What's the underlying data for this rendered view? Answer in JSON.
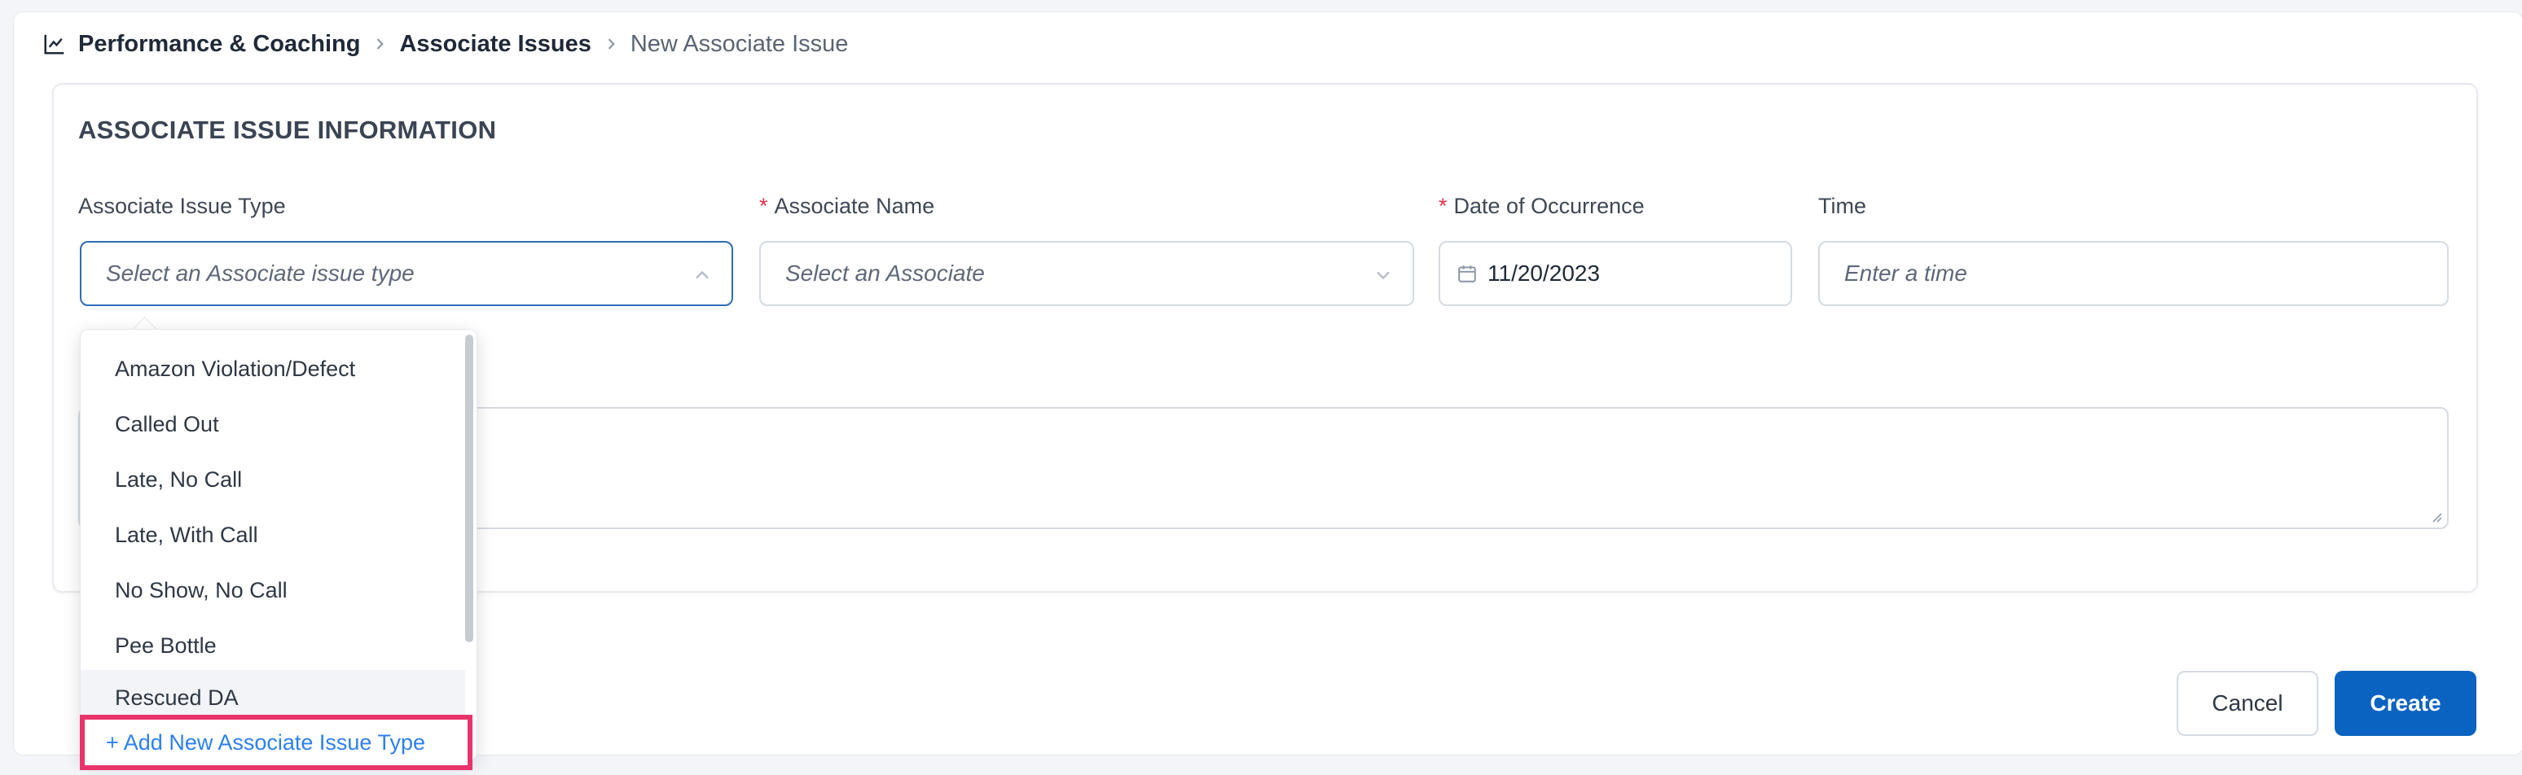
{
  "breadcrumb": {
    "section": "Performance & Coaching",
    "parent": "Associate Issues",
    "current": "New Associate Issue"
  },
  "section_title": "ASSOCIATE ISSUE INFORMATION",
  "fields": {
    "issue_type": {
      "label": "Associate Issue Type",
      "placeholder": "Select an Associate issue type"
    },
    "associate_name": {
      "required_mark": "*",
      "label": "Associate Name",
      "placeholder": "Select an Associate"
    },
    "date": {
      "required_mark": "*",
      "label": "Date of Occurrence",
      "value": "11/20/2023"
    },
    "time": {
      "label": "Time",
      "placeholder": "Enter a time"
    }
  },
  "dropdown": {
    "options": [
      "Amazon Violation/Defect",
      "Called Out",
      "Late, No Call",
      "Late, With Call",
      "No Show, No Call",
      "Pee Bottle",
      "Rescued DA"
    ],
    "add_new_label": "+ Add New Associate Issue Type"
  },
  "actions": {
    "cancel_label": "Cancel",
    "create_label": "Create"
  },
  "colors": {
    "primary": "#0b63c1",
    "link": "#2d7ff0",
    "highlight_border": "#e8336b",
    "required": "#e0324b"
  }
}
